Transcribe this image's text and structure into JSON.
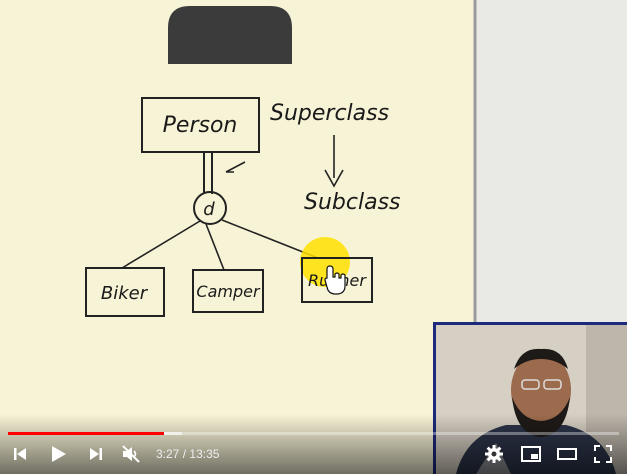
{
  "whiteboard": {
    "boxes": {
      "person": "Person",
      "biker": "Biker",
      "camper": "Camper",
      "runner": "Runner"
    },
    "disjoint_symbol": "d",
    "superclass_label": "Superclass",
    "subclass_label": "Subclass",
    "highlight_color": "#ffe000"
  },
  "player": {
    "current_time": "3:27",
    "separator": "/",
    "duration": "13:35",
    "progress": 0.255,
    "buffered": 0.285,
    "progress_color": "#ff0000",
    "icons": {
      "prev": "skip-previous-icon",
      "play": "play-icon",
      "next": "skip-next-icon",
      "volume": "volume-muted-icon",
      "settings": "gear-icon",
      "miniplayer": "miniplayer-icon",
      "theater": "theater-mode-icon",
      "fullscreen": "fullscreen-icon"
    }
  }
}
